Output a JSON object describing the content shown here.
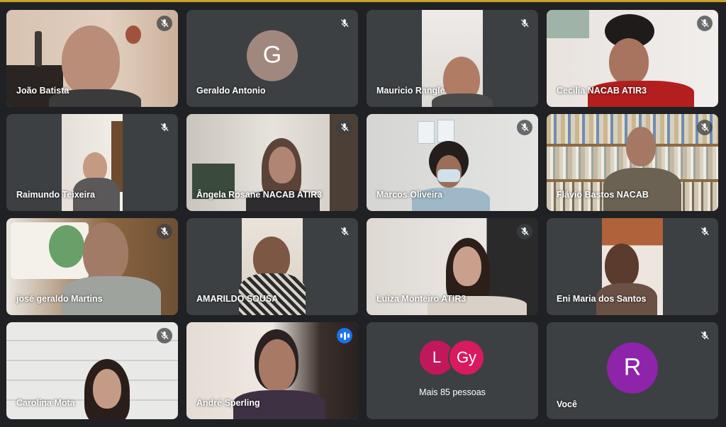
{
  "participants": [
    {
      "name": "João Batista",
      "muted": true
    },
    {
      "name": "Geraldo Antonio",
      "muted": true,
      "avatar_letter": "G",
      "avatar_color": "#a1887f"
    },
    {
      "name": "Mauricio Rangle",
      "muted": true
    },
    {
      "name": "Cecilia NACAB ATIR3",
      "muted": true
    },
    {
      "name": "Raimundo Teixeira",
      "muted": true
    },
    {
      "name": "Ângela Rosane NACAB ATIR3",
      "muted": true
    },
    {
      "name": "Marcos Oliveira",
      "muted": true
    },
    {
      "name": "Flávio Bastos NACAB",
      "muted": true
    },
    {
      "name": "josé geraldo Martins",
      "muted": true
    },
    {
      "name": "AMARILDO SOUSA",
      "muted": true
    },
    {
      "name": "Luiza Monteiro ATIR3",
      "muted": true
    },
    {
      "name": "Eni Maria dos Santos",
      "muted": true
    },
    {
      "name": "Carolina Mota",
      "muted": true
    },
    {
      "name": "André Sperling",
      "muted": false,
      "speaking": true
    }
  ],
  "more": {
    "avatars": [
      {
        "letter": "L",
        "color": "#c2185b"
      },
      {
        "letter": "Gy",
        "color": "#d81b60"
      }
    ],
    "label": "Mais 85 pessoas"
  },
  "self": {
    "name": "Você",
    "avatar_letter": "R",
    "avatar_color": "#8e24aa"
  }
}
